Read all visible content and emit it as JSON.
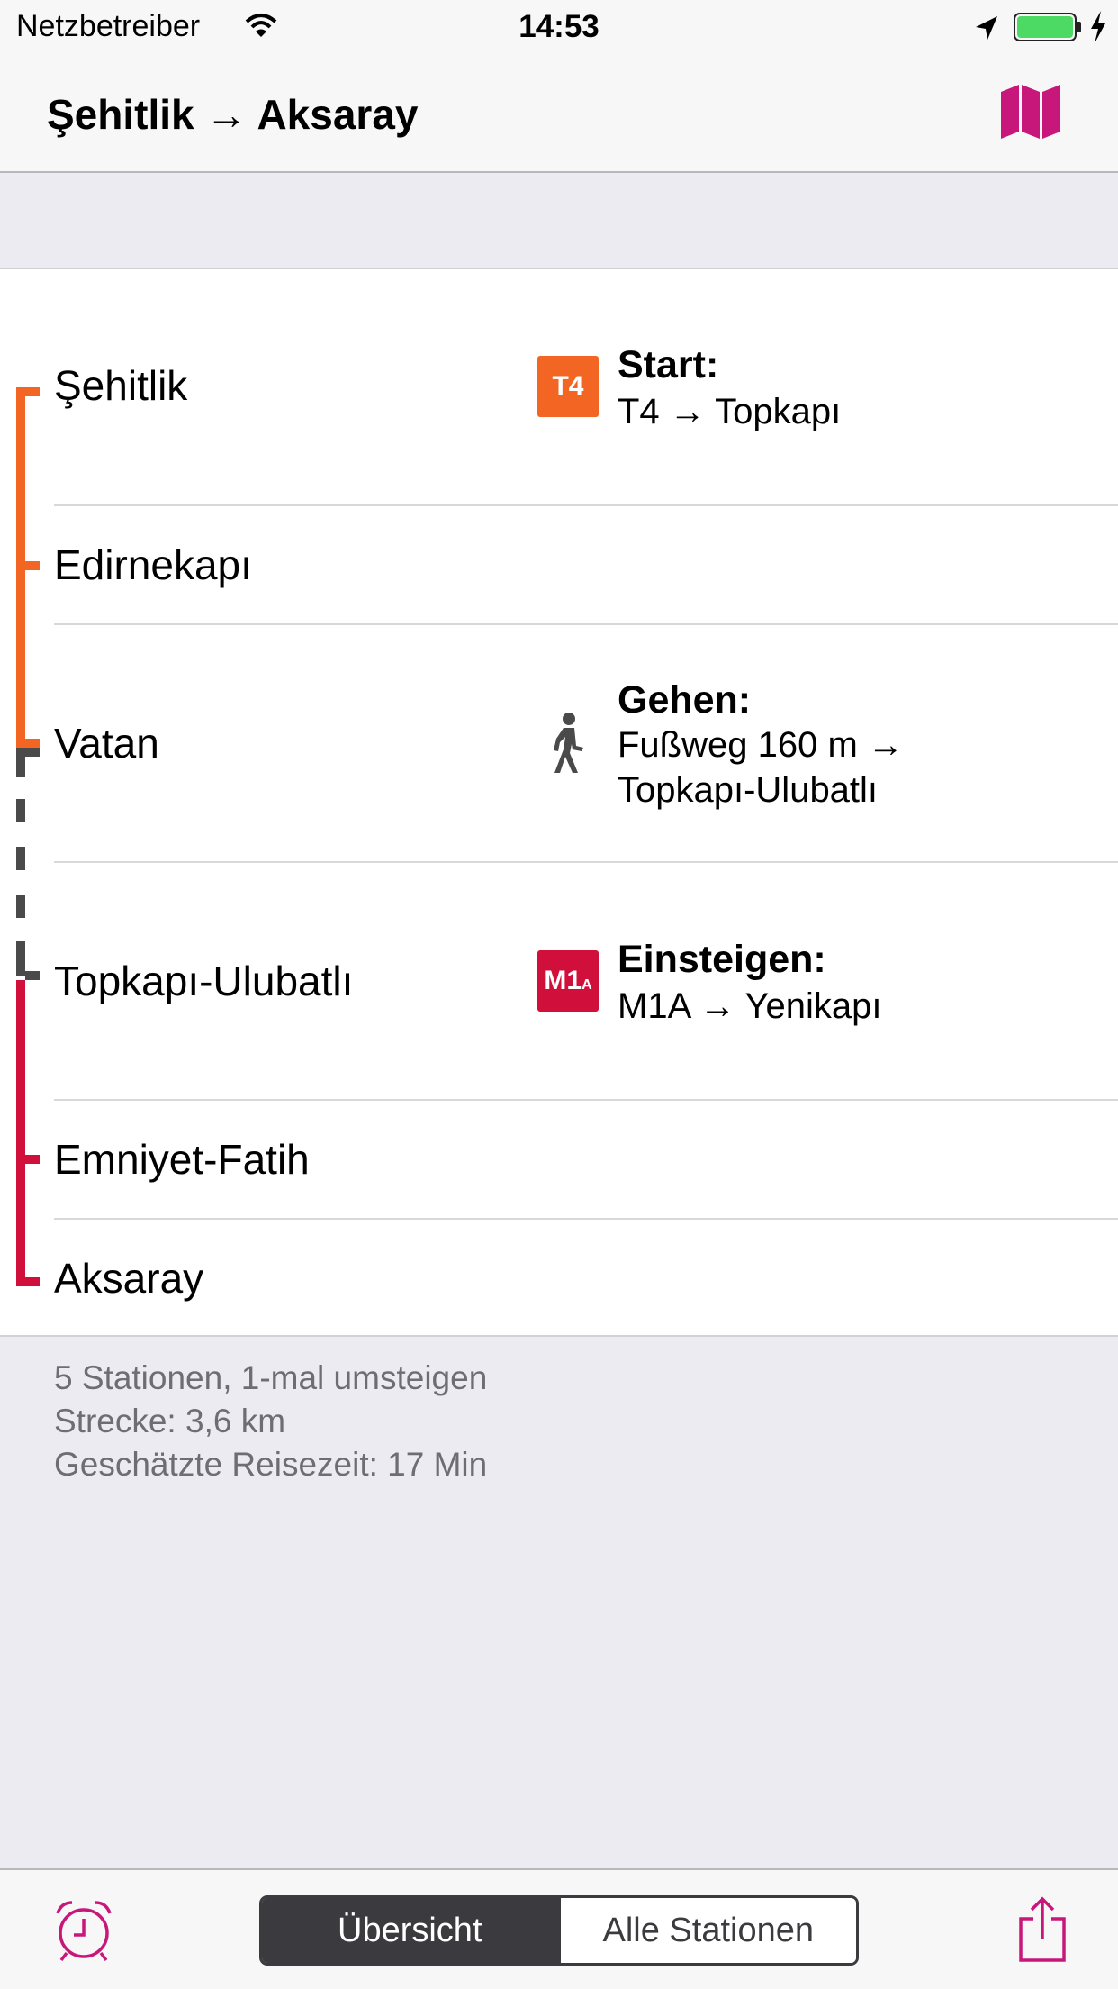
{
  "status_bar": {
    "carrier": "Netzbetreiber",
    "time": "14:53"
  },
  "nav": {
    "title": "Şehitlik → Aksaray",
    "map_icon": "map-icon",
    "accent_color": "#c8177a"
  },
  "route": {
    "stations": [
      {
        "name": "Şehitlik"
      },
      {
        "name": "Edirnekapı"
      },
      {
        "name": "Vatan"
      },
      {
        "name": "Topkapı-Ulubatlı"
      },
      {
        "name": "Emniyet-Fatih"
      },
      {
        "name": "Aksaray"
      }
    ],
    "segments": [
      {
        "line": "T4",
        "color": "#f26522",
        "style": "solid"
      },
      {
        "line": "walk",
        "color": "#4a4a4a",
        "style": "dashed"
      },
      {
        "line": "M1A",
        "color": "#d0103a",
        "style": "solid"
      }
    ],
    "instructions": [
      {
        "badge": "T4",
        "badge_color": "#f26522",
        "title": "Start:",
        "lines": [
          "T4 → Topkapı"
        ]
      },
      {
        "icon": "walking-person-icon",
        "title": "Gehen:",
        "lines": [
          "Fußweg 160 m →",
          "Topkapı-Ulubatlı"
        ]
      },
      {
        "badge": "M1",
        "badge_sub": "A",
        "badge_color": "#d0103a",
        "title": "Einsteigen:",
        "lines": [
          "M1A → Yenikapı"
        ]
      }
    ]
  },
  "summary": {
    "stations": "5 Stationen, 1-mal umsteigen",
    "distance": "Strecke: 3,6 km",
    "duration": "Geschätzte Reisezeit: 17 Min"
  },
  "toolbar": {
    "alarm_icon": "alarm-clock-icon",
    "segments": [
      "Übersicht",
      "Alle Stationen"
    ],
    "selected_segment": "Übersicht",
    "share_icon": "share-icon"
  }
}
